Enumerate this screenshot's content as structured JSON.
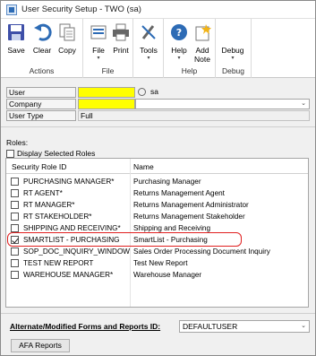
{
  "window": {
    "title": "User Security Setup  -  TWO (sa)"
  },
  "ribbon": {
    "groups": [
      {
        "name": "Actions",
        "buttons": [
          {
            "label": "Save",
            "icon": "save-icon"
          },
          {
            "label": "Clear",
            "icon": "undo-icon"
          },
          {
            "label": "Copy",
            "icon": "copy-icon"
          }
        ]
      },
      {
        "name": "File",
        "buttons": [
          {
            "label": "File",
            "icon": "folder-icon",
            "dropdown": "▾"
          },
          {
            "label": "Print",
            "icon": "printer-icon"
          }
        ]
      },
      {
        "name": "",
        "buttons": [
          {
            "label": "Tools",
            "icon": "tools-icon",
            "dropdown": "▾"
          }
        ]
      },
      {
        "name": "Help",
        "buttons": [
          {
            "label": "Help",
            "icon": "help-icon",
            "dropdown": "▾"
          },
          {
            "label": "Add\nNote",
            "icon": "add-note-icon"
          }
        ]
      },
      {
        "name": "Debug",
        "buttons": [
          {
            "label": "Debug",
            "icon": "debug-icon",
            "dropdown": "▾"
          }
        ]
      }
    ]
  },
  "form": {
    "user_label": "User",
    "user_value": "",
    "user_name_value": "sa",
    "company_label": "Company",
    "company_value": "",
    "user_type_label": "User Type",
    "user_type_value": "Full",
    "roles_label": "Roles:",
    "display_selected_roles_label": "Display Selected Roles"
  },
  "grid": {
    "headers": [
      "Security Role ID",
      "Name"
    ],
    "rows": [
      {
        "id": "PURCHASING MANAGER*",
        "name": "Purchasing Manager",
        "checked": false
      },
      {
        "id": "RT AGENT*",
        "name": "Returns Management Agent",
        "checked": false
      },
      {
        "id": "RT MANAGER*",
        "name": "Returns Management Administrator",
        "checked": false
      },
      {
        "id": "RT STAKEHOLDER*",
        "name": "Returns Management Stakeholder",
        "checked": false
      },
      {
        "id": "SHIPPING AND RECEIVING*",
        "name": "Shipping and Receiving",
        "checked": false
      },
      {
        "id": "SMARTLIST - PURCHASING",
        "name": "SmartList - Purchasing",
        "checked": true
      },
      {
        "id": "SOP_DOC_INQUIRY_WINDOW",
        "name": "Sales Order Processing Document Inquiry",
        "checked": false
      },
      {
        "id": "TEST NEW REPORT",
        "name": "Test New Report",
        "checked": false
      },
      {
        "id": "WAREHOUSE MANAGER*",
        "name": "Warehouse Manager",
        "checked": false
      }
    ]
  },
  "bottom": {
    "afa_label": "Alternate/Modified Forms and Reports ID:",
    "afa_value": "DEFAULTUSER",
    "afa_button": "AFA Reports"
  },
  "colors": {
    "highlight": "#ffff00",
    "annotation": "#e02020",
    "accent": "#2d6bb5"
  }
}
